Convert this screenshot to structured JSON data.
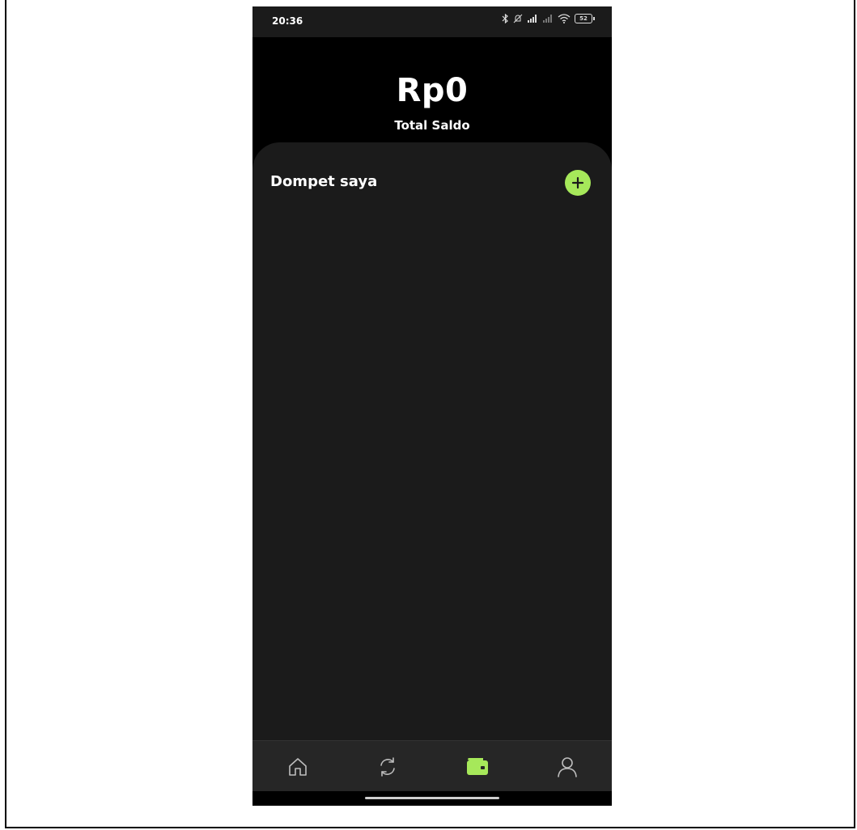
{
  "status_bar": {
    "time": "20:36",
    "battery": "52",
    "icons": [
      "bluetooth-icon",
      "mute-icon",
      "signal-icon",
      "signal-weak-icon",
      "wifi-icon",
      "battery-icon"
    ]
  },
  "header": {
    "total_amount": "Rp0",
    "total_label": "Total Saldo"
  },
  "wallet_section": {
    "title": "Dompet saya",
    "add_icon": "plus-icon"
  },
  "bottom_nav": {
    "active": "wallet",
    "items": [
      {
        "name": "home",
        "icon": "home-icon"
      },
      {
        "name": "transactions",
        "icon": "refresh-icon"
      },
      {
        "name": "wallet",
        "icon": "wallet-icon"
      },
      {
        "name": "profile",
        "icon": "user-icon"
      }
    ]
  },
  "colors": {
    "accent": "#a6e85a",
    "background": "#000000",
    "surface": "#1b1b1b",
    "nav_background": "#262626"
  }
}
